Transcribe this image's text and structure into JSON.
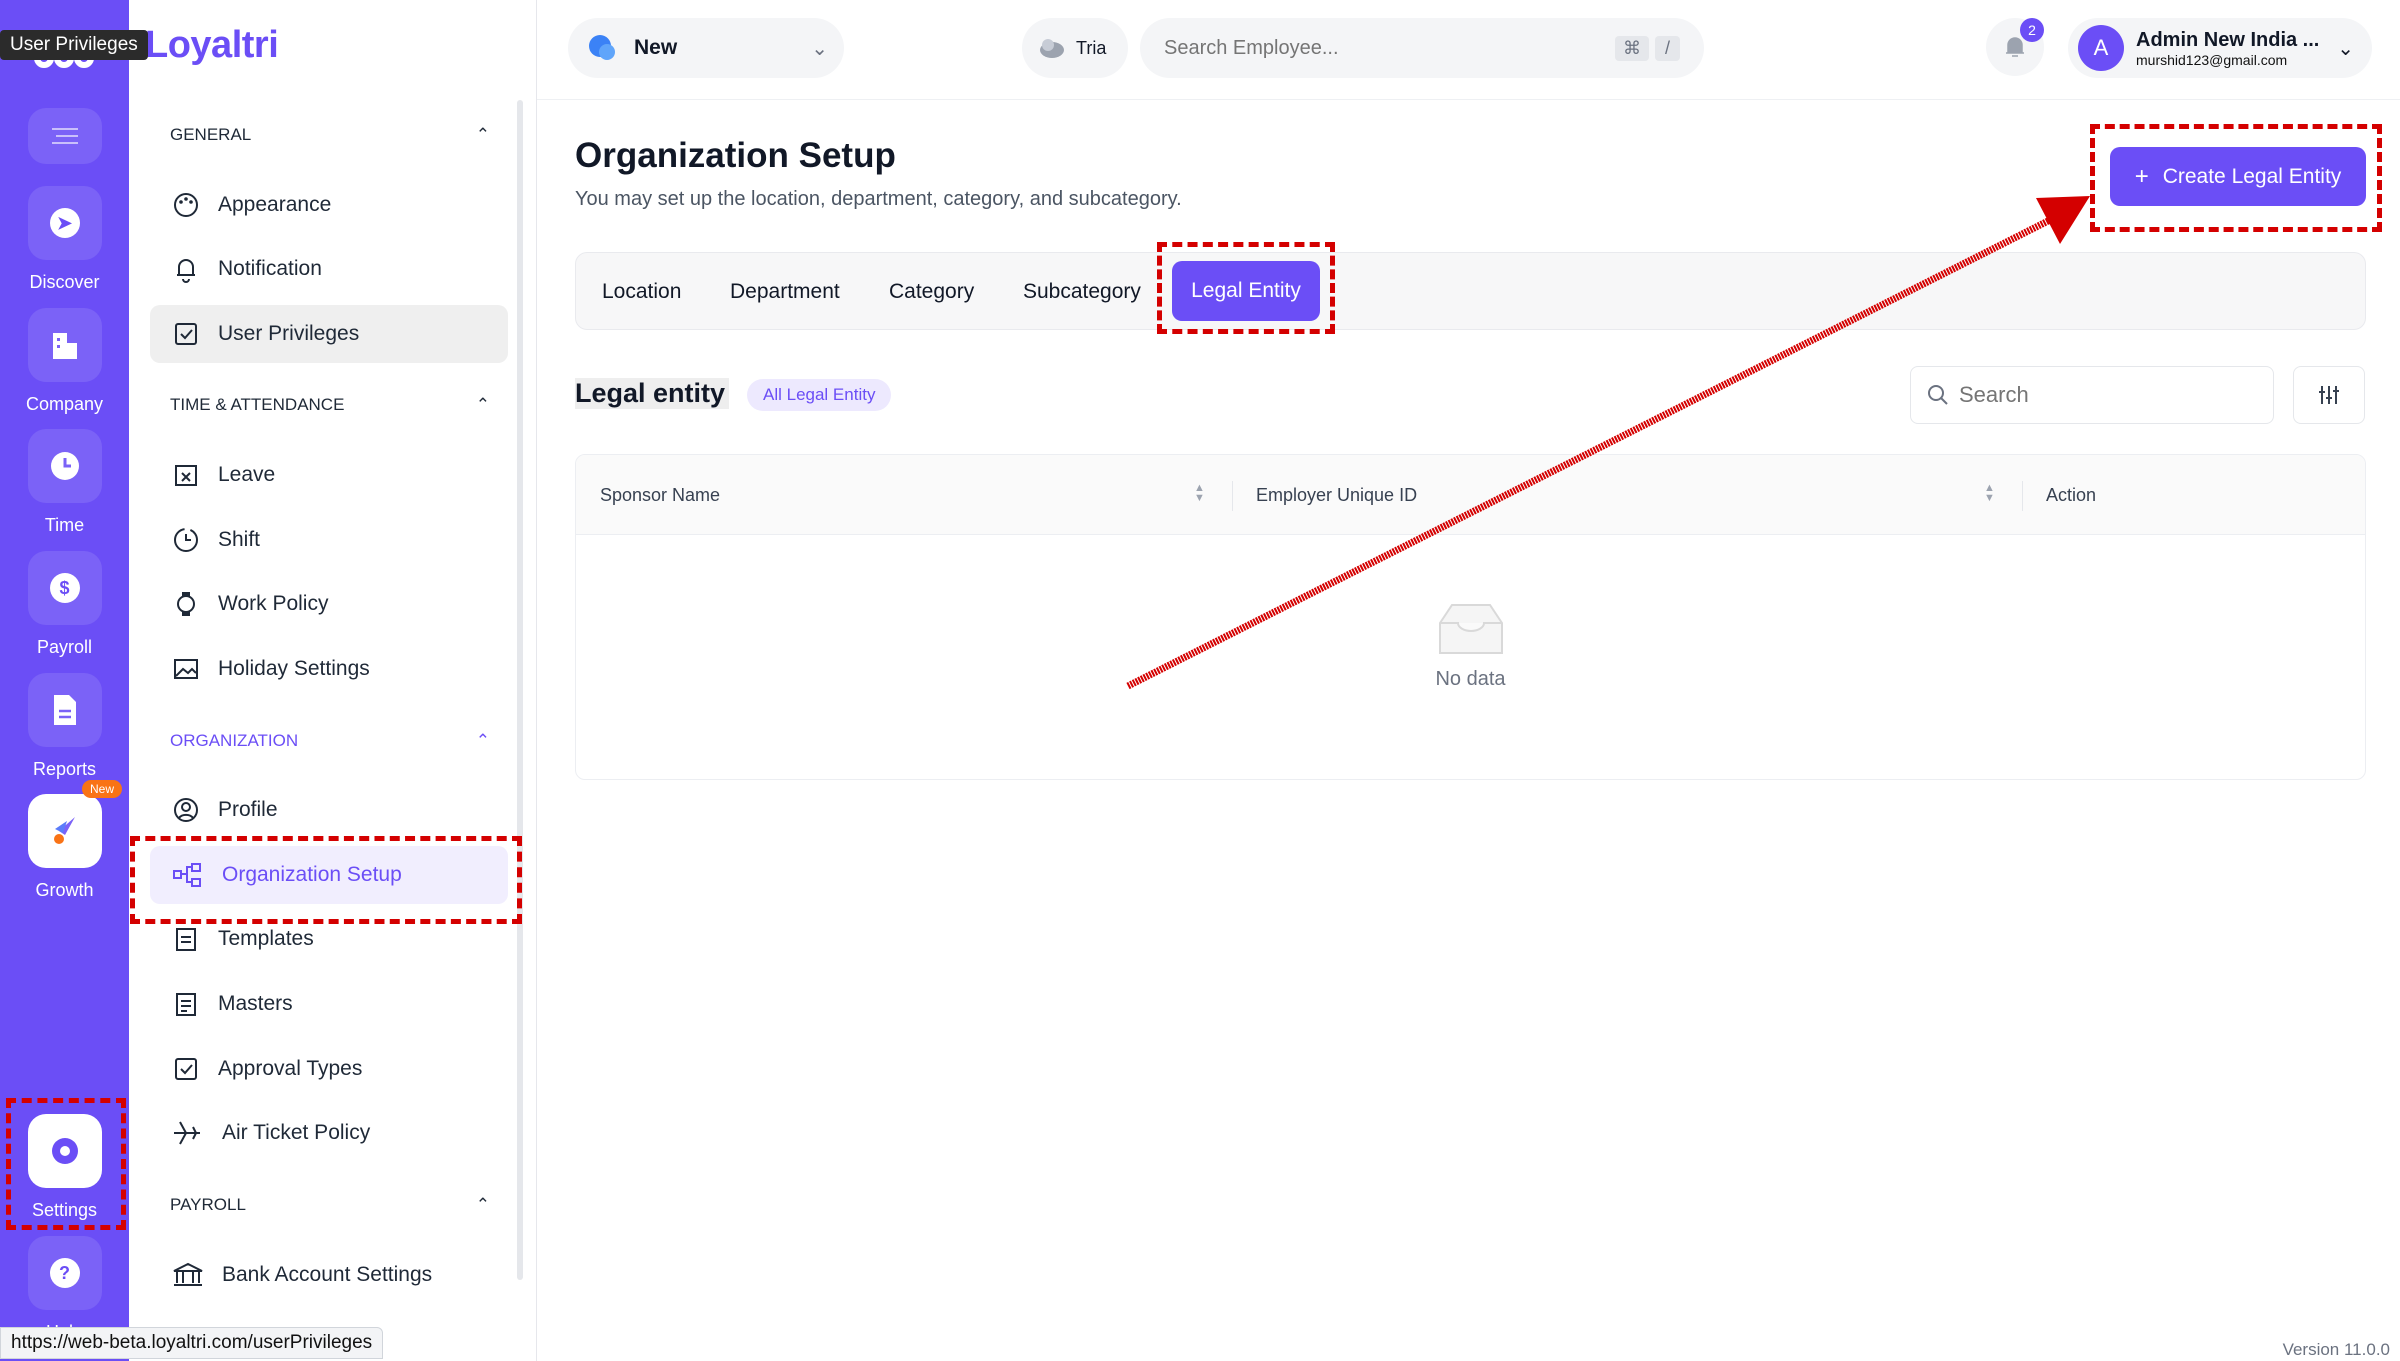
{
  "tooltip": "User Privileges",
  "brand": "Loyaltri",
  "rail": {
    "items": [
      {
        "label": "Discover"
      },
      {
        "label": "Company"
      },
      {
        "label": "Time"
      },
      {
        "label": "Payroll"
      },
      {
        "label": "Reports"
      },
      {
        "label": "Growth",
        "badge": "New"
      },
      {
        "label": "Settings"
      },
      {
        "label": "Help"
      }
    ]
  },
  "sidebar": {
    "sections": {
      "general": "GENERAL",
      "time": "TIME & ATTENDANCE",
      "organization": "ORGANIZATION",
      "payroll": "PAYROLL"
    },
    "items": {
      "appearance": "Appearance",
      "notification": "Notification",
      "user_privileges": "User Privileges",
      "leave": "Leave",
      "shift": "Shift",
      "work_policy": "Work Policy",
      "holiday": "Holiday Settings",
      "profile": "Profile",
      "org_setup": "Organization Setup",
      "templates": "Templates",
      "masters": "Masters",
      "approval": "Approval Types",
      "air_ticket": "Air Ticket Policy",
      "bank": "Bank Account Settings"
    }
  },
  "topbar": {
    "company": "New",
    "assistant": "Tria",
    "search_placeholder": "Search Employee...",
    "shortcut_cmd": "⌘",
    "shortcut_key": "/",
    "notifications": "2",
    "avatar": "A",
    "user_name": "Admin New India ...",
    "user_email": "murshid123@gmail.com"
  },
  "page": {
    "title": "Organization Setup",
    "subtitle": "You may set up the location, department, category, and subcategory.",
    "create_button": "Create Legal Entity",
    "create_icon": "+",
    "tabs": [
      "Location",
      "Department",
      "Category",
      "Subcategory",
      "Legal Entity"
    ],
    "section_title": "Legal entity",
    "filter_badge": "All Legal Entity",
    "search_placeholder": "Search",
    "columns": [
      "Sponsor Name",
      "Employer Unique ID",
      "Action"
    ],
    "empty": "No data"
  },
  "status_url": "https://web-beta.loyaltri.com/userPrivileges",
  "version": "Version 11.0.0",
  "colors": {
    "accent": "#6b4ef6",
    "annotation": "#d40000"
  }
}
